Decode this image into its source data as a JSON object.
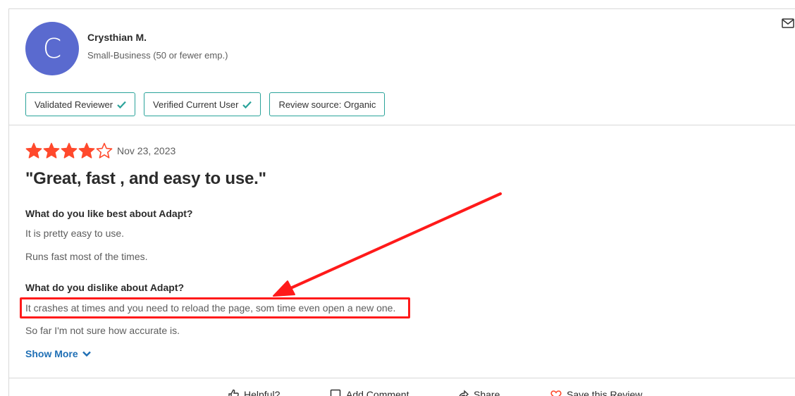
{
  "reviewer": {
    "avatar_letter": "C",
    "name": "Crysthian M.",
    "company_size": "Small-Business (50 or fewer emp.)"
  },
  "badges": [
    {
      "label": "Validated Reviewer",
      "checked": true
    },
    {
      "label": "Verified Current User",
      "checked": true
    },
    {
      "label": "Review source: Organic",
      "checked": false
    }
  ],
  "review": {
    "rating": 4,
    "max_rating": 5,
    "date": "Nov 23, 2023",
    "title": "\"Great, fast , and easy to use.\"",
    "q1": "What do you like best about Adapt?",
    "a1_line1": "It is pretty easy to use.",
    "a1_line2": "Runs fast most of the times.",
    "q2": "What do you dislike about Adapt?",
    "a2_line1": "It crashes at times and you need to reload the page, som time even open a new one.",
    "a2_line2": "So far I'm not sure how accurate is.",
    "show_more": "Show More"
  },
  "actions": {
    "helpful": "Helpful?",
    "add_comment": "Add Comment",
    "share": "Share",
    "save": "Save this Review"
  },
  "colors": {
    "star": "#ff492c",
    "badge_border": "#2aa39a",
    "check": "#2aa39a",
    "avatar": "#5a6acf",
    "link": "#1f6fb5",
    "annotation": "#ff1a1a"
  },
  "icons": {
    "mail": "mail-icon",
    "check": "check-icon",
    "star": "star-icon",
    "chevron": "chevron-down-icon",
    "thumbs_up": "thumbs-up-icon",
    "comment": "comment-icon",
    "share": "share-icon",
    "heart": "heart-icon"
  }
}
